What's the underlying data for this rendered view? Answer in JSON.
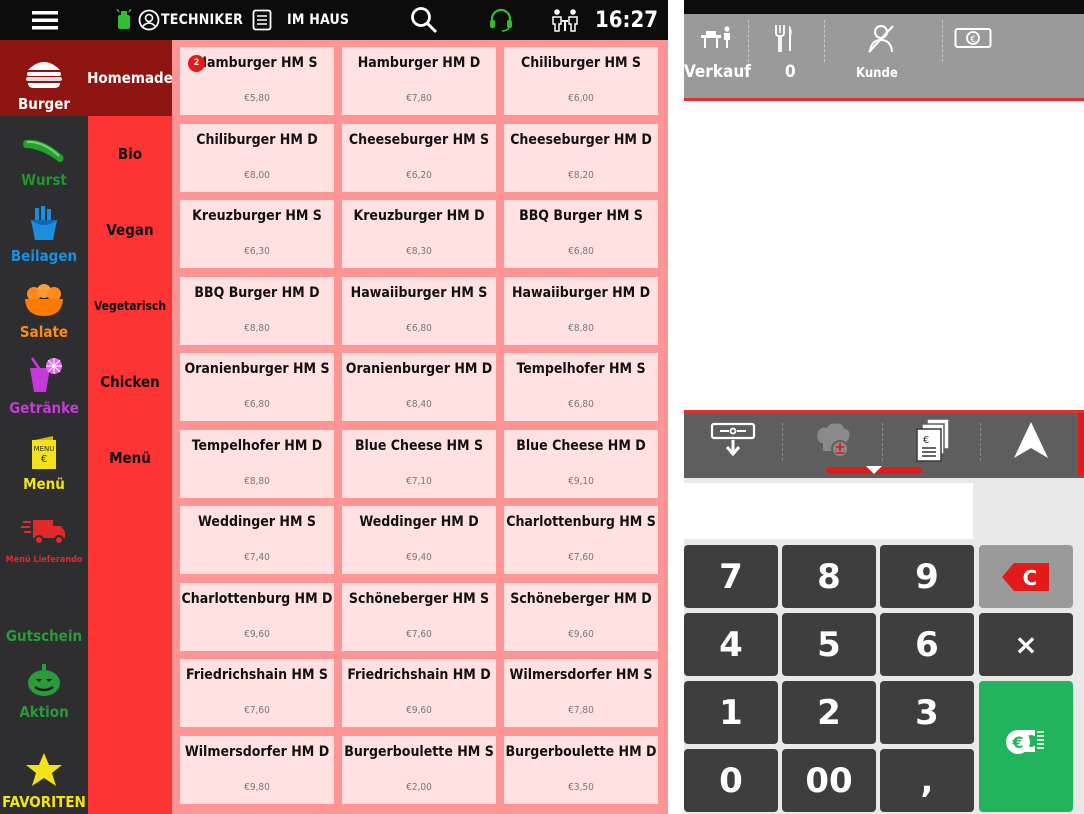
{
  "topbar": {
    "user_label": "TECHNIKER",
    "mode_label": "IM HAUS",
    "time": "16:27"
  },
  "categories": [
    {
      "label": "Burger",
      "color": "#ffffff",
      "icon": "burger-icon"
    },
    {
      "label": "Wurst",
      "color": "#1e9a2a",
      "icon": "sausage-icon"
    },
    {
      "label": "Beilagen",
      "color": "#1a8fe0",
      "icon": "fries-icon"
    },
    {
      "label": "Salate",
      "color": "#ff8a1a",
      "icon": "salad-icon"
    },
    {
      "label": "Getränke",
      "color": "#c43bd9",
      "icon": "drink-icon"
    },
    {
      "label": "Menü",
      "color": "#f2e21a",
      "icon": "menu-card-icon"
    },
    {
      "label": "Menü Lieferando",
      "color": "#e02a2a",
      "icon": "delivery-truck-icon"
    },
    {
      "label": "Gutschein",
      "color": "#2a9a3a",
      "icon": "voucher-icon"
    },
    {
      "label": "Aktion",
      "color": "#2a9a3a",
      "icon": "pumpkin-icon"
    },
    {
      "label": "FAVORITEN",
      "color": "#f2e21a",
      "icon": "star-icon"
    }
  ],
  "subcategories": [
    "Homemade",
    "Bio",
    "Vegan",
    "Vegetarisch",
    "Chicken",
    "Menü"
  ],
  "products": [
    {
      "name": "Hamburger HM S",
      "price": "€5,80",
      "badge": "2"
    },
    {
      "name": "Hamburger HM D",
      "price": "€7,80"
    },
    {
      "name": "Chiliburger HM S",
      "price": "€6,00"
    },
    {
      "name": "Chiliburger HM D",
      "price": "€8,00"
    },
    {
      "name": "Cheeseburger HM S",
      "price": "€6,20"
    },
    {
      "name": "Cheeseburger HM D",
      "price": "€8,20"
    },
    {
      "name": "Kreuzburger HM S",
      "price": "€6,30"
    },
    {
      "name": "Kreuzburger HM D",
      "price": "€8,30"
    },
    {
      "name": "BBQ Burger HM S",
      "price": "€6,80"
    },
    {
      "name": "BBQ Burger HM D",
      "price": "€8,80"
    },
    {
      "name": "Hawaiiburger HM S",
      "price": "€6,80"
    },
    {
      "name": "Hawaiiburger HM D",
      "price": "€8,80"
    },
    {
      "name": "Oranienburger HM S",
      "price": "€6,80"
    },
    {
      "name": "Oranienburger HM D",
      "price": "€8,40"
    },
    {
      "name": "Tempelhofer HM S",
      "price": "€6,80"
    },
    {
      "name": "Tempelhofer HM D",
      "price": "€8,80"
    },
    {
      "name": "Blue Cheese HM S",
      "price": "€7,10"
    },
    {
      "name": "Blue Cheese HM D",
      "price": "€9,10"
    },
    {
      "name": "Weddinger HM S",
      "price": "€7,40"
    },
    {
      "name": "Weddinger HM D",
      "price": "€9,40"
    },
    {
      "name": "Charlottenburg HM S",
      "price": "€7,60"
    },
    {
      "name": "Charlottenburg HM D",
      "price": "€9,60"
    },
    {
      "name": "Schöneberger HM S",
      "price": "€7,60"
    },
    {
      "name": "Schöneberger HM D",
      "price": "€9,60"
    },
    {
      "name": "Friedrichshain HM S",
      "price": "€7,60"
    },
    {
      "name": "Friedrichshain HM D",
      "price": "€9,60"
    },
    {
      "name": "Wilmersdorfer HM S",
      "price": "€7,80"
    },
    {
      "name": "Wilmersdorfer HM D",
      "price": "€9,80"
    },
    {
      "name": "Burgerboulette HM S",
      "price": "€2,00"
    },
    {
      "name": "Burgerboulette HM D",
      "price": "€3,50"
    }
  ],
  "order_header": {
    "verkauf_label": "Verkauf",
    "guest_count": "0",
    "kunde_label": "Kunde"
  },
  "keypad": {
    "amount_value": "",
    "keys": [
      "7",
      "8",
      "9",
      "4",
      "5",
      "6",
      "1",
      "2",
      "3",
      "0",
      "00",
      ","
    ],
    "clear_label": "C",
    "multiply_label": "×"
  },
  "colors": {
    "active_red": "#8e1512",
    "accent_red": "#fe3333",
    "tile_bg": "#ffe1e1",
    "pay_green": "#22b45c"
  }
}
